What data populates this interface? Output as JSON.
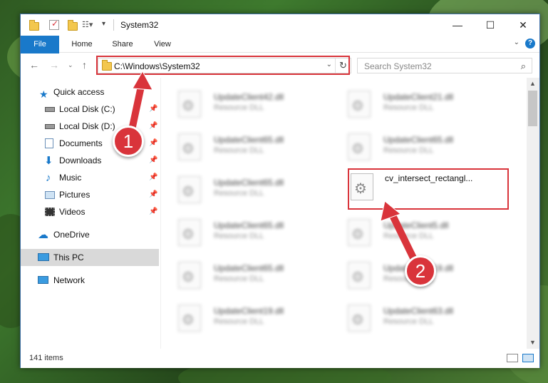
{
  "window": {
    "title": "System32",
    "minimize": "—",
    "maximize": "☐",
    "close": "✕"
  },
  "ribbon": {
    "tabs": [
      "File",
      "Home",
      "Share",
      "View"
    ],
    "help": "?"
  },
  "address": {
    "path": "C:\\Windows\\System32",
    "search_placeholder": "Search System32"
  },
  "sidebar": {
    "items": [
      {
        "label": "Quick access",
        "icon": "star-icon"
      },
      {
        "label": "Local Disk (C:)",
        "icon": "drive-icon",
        "pinned": true
      },
      {
        "label": "Local Disk (D:)",
        "icon": "drive-icon",
        "pinned": true
      },
      {
        "label": "Documents",
        "icon": "documents-icon",
        "pinned": true
      },
      {
        "label": "Downloads",
        "icon": "download-icon",
        "pinned": true
      },
      {
        "label": "Music",
        "icon": "music-icon",
        "pinned": true
      },
      {
        "label": "Pictures",
        "icon": "pictures-icon",
        "pinned": true
      },
      {
        "label": "Videos",
        "icon": "videos-icon",
        "pinned": true
      },
      {
        "label": "OneDrive",
        "icon": "cloud-icon"
      },
      {
        "label": "This PC",
        "icon": "computer-icon",
        "selected": true
      },
      {
        "label": "Network",
        "icon": "network-icon"
      }
    ]
  },
  "files": [
    {
      "name": "UpdateClient42.dll",
      "type": "Resource DLL"
    },
    {
      "name": "UpdateClient21.dll",
      "type": "Resource DLL"
    },
    {
      "name": "UpdateClient65.dll",
      "type": "Resource DLL"
    },
    {
      "name": "UpdateClient65.dll",
      "type": "Resource DLL"
    },
    {
      "name": "UpdateClient65.dll",
      "type": "Resource DLL"
    },
    {
      "name": "cv_intersect_rectangl...",
      "type": ""
    },
    {
      "name": "UpdateClient65.dll",
      "type": "Resource DLL"
    },
    {
      "name": "UpdateClient5.dll",
      "type": "Resource DLL"
    },
    {
      "name": "UpdateClient65.dll",
      "type": "Resource DLL"
    },
    {
      "name": "UpdateClient19.dll",
      "type": "Resource DLL"
    },
    {
      "name": "UpdateClient19.dll",
      "type": "Resource DLL"
    },
    {
      "name": "UpdateClient63.dll",
      "type": "Resource DLL"
    }
  ],
  "status": {
    "item_count": "141 items"
  },
  "annotations": {
    "step1": "1",
    "step2": "2",
    "highlight_color": "#d9343b"
  },
  "colors": {
    "accent": "#1979ca",
    "folder": "#f3c74e"
  }
}
